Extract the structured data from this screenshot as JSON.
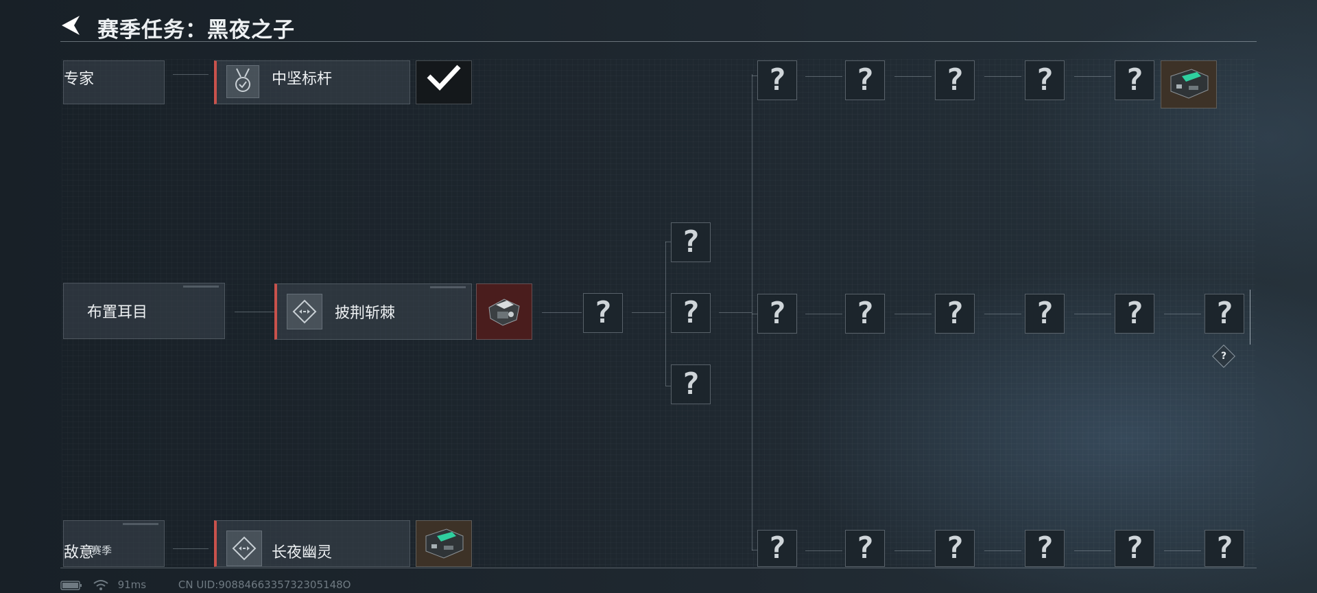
{
  "header": {
    "title": "赛季任务：黑夜之子"
  },
  "quests": {
    "row1_left_label": "专家",
    "row1_main_label": "中坚标杆",
    "row2_left_label": "布置耳目",
    "row2_main_label": "披荆斩棘",
    "row3_left_label": "敌意",
    "row3_left_tag": "赛季",
    "row3_main_label": "长夜幽灵"
  },
  "unknown_mark": "?",
  "status": {
    "ping": "91ms",
    "uid": "CN UID:9088466335732305148O"
  },
  "colors": {
    "accent": "#c9524c",
    "background": "#1b2229",
    "check": "#ffffff"
  },
  "icons": [
    "back-arrow-icon",
    "medal-icon",
    "diamond-arrows-icon",
    "battery-icon",
    "wifi-icon",
    "checkmark-icon"
  ]
}
